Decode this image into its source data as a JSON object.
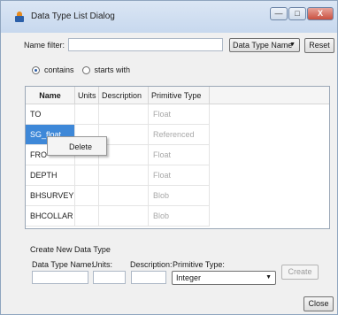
{
  "window": {
    "title": "Data Type List Dialog",
    "icon": "app-icon",
    "controls": {
      "minimize": "—",
      "maximize": "□",
      "close": "X"
    }
  },
  "filter": {
    "label": "Name filter:",
    "value": "",
    "placeholder": "",
    "field_select": "Data Type Name",
    "reset_label": "Reset",
    "options": [
      {
        "label": "contains",
        "selected": true
      },
      {
        "label": "starts with",
        "selected": false
      }
    ]
  },
  "table": {
    "columns": [
      "Name",
      "Units",
      "Description",
      "Primitive Type"
    ],
    "rows": [
      {
        "name": "TO",
        "units": "",
        "description": "",
        "primitive": "Float"
      },
      {
        "name": "SG_float",
        "units": "",
        "description": "",
        "primitive": "Referenced"
      },
      {
        "name": "FRO",
        "units": "",
        "description": "",
        "primitive": "Float"
      },
      {
        "name": "DEPTH",
        "units": "",
        "description": "",
        "primitive": "Float"
      },
      {
        "name": "BHSURVEY",
        "units": "",
        "description": "",
        "primitive": "Blob"
      },
      {
        "name": "BHCOLLAR",
        "units": "",
        "description": "",
        "primitive": "Blob"
      }
    ],
    "selected_row": "SG_float"
  },
  "context_menu": {
    "items": [
      "Delete"
    ]
  },
  "create": {
    "section_label": "Create New Data Type",
    "name_label": "Data Type Name:",
    "units_label": "Units:",
    "description_label": "Description:",
    "primitive_label": "Primitive Type:",
    "primitive_value": "Integer",
    "create_label": "Create"
  },
  "footer": {
    "close_label": "Close"
  },
  "colors": {
    "selection": "#3e88d8",
    "titlebar": "#c7d8ee",
    "disabled_text": "#a8a8a8"
  }
}
